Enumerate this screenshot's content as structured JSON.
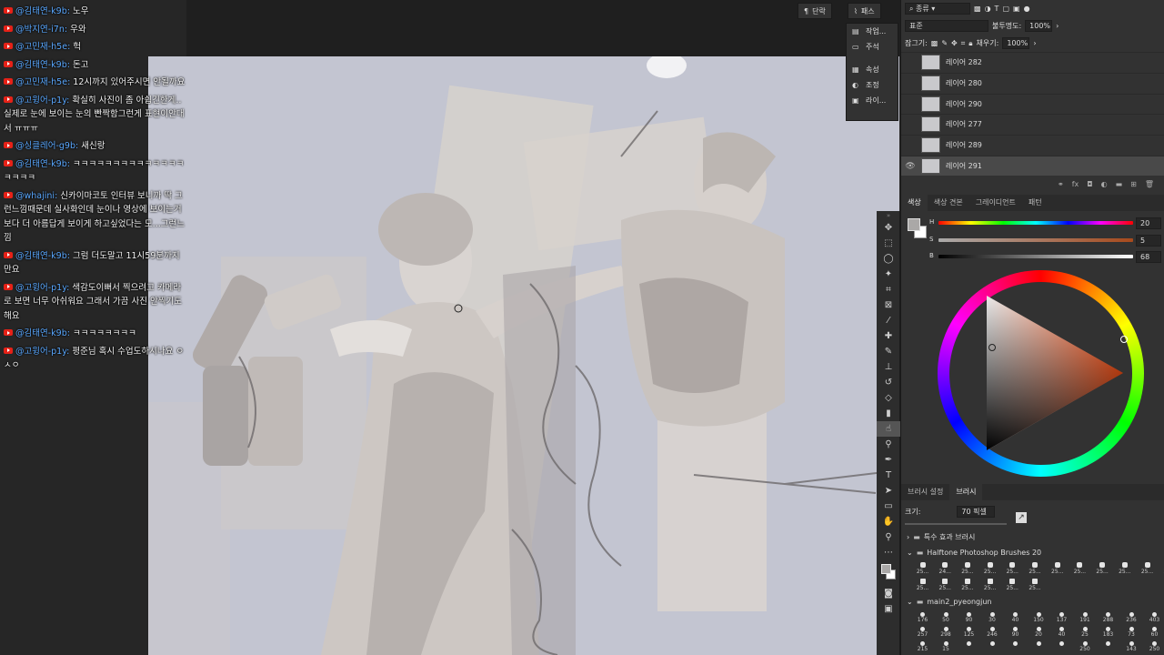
{
  "chat": {
    "messages": [
      {
        "author": "@김태연-k9b",
        "text": "노우"
      },
      {
        "author": "@박지연-i7n",
        "text": "우와"
      },
      {
        "author": "@고민재-h5e",
        "text": "헉"
      },
      {
        "author": "@김태연-k9b",
        "text": "돈고"
      },
      {
        "author": "@고민재-h5e",
        "text": "12시까지 있어주시면 안될까요"
      },
      {
        "author": "@고윙어-p1y",
        "text": "확실히 사진이 좀 아쉽긴한게..실제로 눈에 보이는 눈의 빤짝함그런게 표현이안대서 ㅠㅠㅠ"
      },
      {
        "author": "@싱클레어-g9b",
        "text": "새신랑"
      },
      {
        "author": "@김태연-k9b",
        "text": "ㅋㅋㅋㅋㅋㅋㅋㅋㅋㅋㅋㅋㅋㅋㅋㅋㅋㅋ"
      },
      {
        "author": "@whajini",
        "text": "신카이마코토 인터뷰 보니까 딱 그런느낌때문데 실사화인데 눈이나 영상에 보이는거보다 더 아름답게 보이게 하고싶었다는 모...그런느낌"
      },
      {
        "author": "@김태연-k9b",
        "text": "그럼 더도말고 11시59분까지만요"
      },
      {
        "author": "@고윙어-p1y",
        "text": "색감도이뻐서 찍으려고 카메라로 보면 너무 아쉬워요 그래서 가끔 사진 안찍기도해요"
      },
      {
        "author": "@김태연-k9b",
        "text": "ㅋㅋㅋㅋㅋㅋㅋㅋ"
      },
      {
        "author": "@고윙어-p1y",
        "text": "평준님 혹시 수업도하시나요 ㅇㅅㅇ"
      }
    ]
  },
  "top_strip": {
    "paragraph_label": "단락",
    "paths_label": "패스",
    "mini_items": [
      "작업...",
      "주석",
      "속성",
      "조정",
      "라이..."
    ]
  },
  "layers_panel": {
    "filter_kind": "종류",
    "blend_mode": "표준",
    "opacity_label": "불투명도:",
    "opacity_value": "100%",
    "lock_label": "잠그기:",
    "fill_label": "채우기:",
    "fill_value": "100%",
    "layers": [
      {
        "name": "레이어 282",
        "visible": false,
        "selected": false
      },
      {
        "name": "레이어 280",
        "visible": false,
        "selected": false
      },
      {
        "name": "레이어 290",
        "visible": false,
        "selected": false
      },
      {
        "name": "레이어 277",
        "visible": false,
        "selected": false
      },
      {
        "name": "레이어 289",
        "visible": false,
        "selected": false
      },
      {
        "name": "레이어 291",
        "visible": true,
        "selected": true
      }
    ]
  },
  "color_panel": {
    "tabs": [
      "색상",
      "색상 견본",
      "그레이디언트",
      "패턴"
    ],
    "h_label": "H",
    "s_label": "S",
    "b_label": "B",
    "h_value": "20",
    "s_value": "5",
    "b_value": "68"
  },
  "brush_panel": {
    "tabs": [
      "브러시 설정",
      "브러시"
    ],
    "size_label": "크기:",
    "size_value": "70 픽셀",
    "groups": [
      "특수 효과 브러시",
      "Halftone Photoshop Brushes 20",
      "main2_pyeongjun"
    ],
    "halftone_sizes": [
      "25...",
      "24...",
      "25...",
      "25...",
      "25...",
      "25...",
      "25...",
      "25...",
      "25...",
      "25...",
      "25...",
      "25..."
    ],
    "halftone_sizes_row2": [
      "25...",
      "25...",
      "25...",
      "25...",
      "25...",
      "25..."
    ],
    "main2_row1": [
      "176",
      "50",
      "90",
      "30",
      "40",
      "150",
      "137",
      "191",
      "288",
      "236",
      "403"
    ],
    "main2_row2": [
      "257",
      "298",
      "125",
      "246",
      "90",
      "20",
      "40",
      "25",
      "183",
      "73",
      "60"
    ],
    "main2_row3": [
      "215",
      "15",
      "",
      "",
      "",
      "",
      "",
      "250",
      "",
      "143",
      "250"
    ]
  },
  "colors": {
    "canvas_bg": "#c3c5d1",
    "panel_bg": "#323232",
    "chat_author": "#5aa8ff",
    "accent_selected_layer": "#494949"
  }
}
